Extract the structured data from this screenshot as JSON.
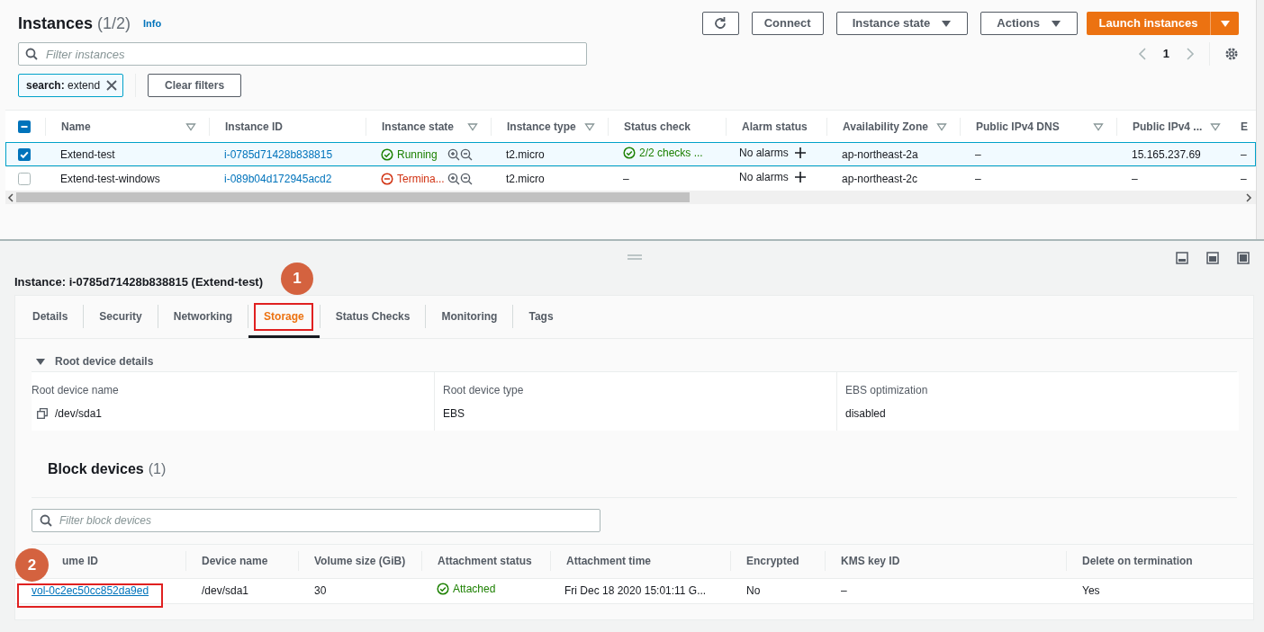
{
  "header": {
    "title": "Instances",
    "count": "(1/2)",
    "info": "Info"
  },
  "toolbar": [
    {
      "kind": "refresh"
    },
    {
      "kind": "plain",
      "label": "Connect"
    },
    {
      "kind": "dropdown",
      "label": "Instance state"
    },
    {
      "kind": "dropdown",
      "label": "Actions"
    },
    {
      "kind": "primary",
      "label": "Launch instances"
    }
  ],
  "filter": {
    "placeholder": "Filter instances"
  },
  "pagination": {
    "page": "1"
  },
  "tokens": [
    {
      "text": "**search:** extend"
    }
  ],
  "clear_filters": "Clear filters",
  "instances": {
    "header_indeterminate": true,
    "columns": [
      {
        "label": "Name",
        "filter": true
      },
      {
        "label": "Instance ID",
        "filter": false
      },
      {
        "label": "Instance state",
        "filter": true
      },
      {
        "label": "Instance type",
        "filter": true
      },
      {
        "label": "Status check",
        "filter": false
      },
      {
        "label": "Alarm status",
        "filter": false
      },
      {
        "label": "Availability Zone",
        "filter": true
      },
      {
        "label": "Public IPv4 DNS",
        "filter": true
      },
      {
        "label": "Public IPv4 ...",
        "filter": true
      },
      {
        "label": "E",
        "filter": false
      }
    ],
    "rows": [
      {
        "selected": true,
        "name": "Extend-test",
        "id": "i-0785d71428b838815",
        "state": {
          "kind": "running",
          "text": "Running"
        },
        "type": "t2.micro",
        "status_check": {
          "kind": "ok",
          "text": "2/2 checks ..."
        },
        "alarm": "No alarms",
        "zone": "ap-northeast-2a",
        "dns": "–",
        "ipv4": "15.165.237.69",
        "column_10": "–"
      },
      {
        "selected": false,
        "name": "Extend-test-windows",
        "id": "i-089b04d172945acd2",
        "state": {
          "kind": "terminated",
          "text": "Termina..."
        },
        "type": "t2.micro",
        "status_check": {
          "kind": "none",
          "text": "–"
        },
        "alarm": "No alarms",
        "zone": "ap-northeast-2c",
        "dns": "–",
        "ipv4": "–",
        "column_10": "–"
      }
    ]
  },
  "detail": {
    "title": "Instance: i-0785d71428b838815 (Extend-test)",
    "tabs": [
      {
        "label": "Details",
        "selected": false
      },
      {
        "label": "Security",
        "selected": false
      },
      {
        "label": "Networking",
        "selected": false
      },
      {
        "label": "Storage",
        "selected": true,
        "callout": "1"
      },
      {
        "label": "Status Checks",
        "selected": false
      },
      {
        "label": "Monitoring",
        "selected": false
      },
      {
        "label": "Tags",
        "selected": false
      }
    ],
    "root_device": {
      "heading": "Root device details",
      "expanded": true,
      "fields": [
        {
          "label": "Root device name",
          "value": "/dev/sda1",
          "copyable": true
        },
        {
          "label": "Root device type",
          "value": "EBS",
          "copyable": false
        },
        {
          "label": "EBS optimization",
          "value": "disabled",
          "copyable": false
        }
      ]
    },
    "block_devices": {
      "title": "Block devices",
      "count": "(1)",
      "filter_placeholder": "Filter block devices",
      "columns": [
        "ume ID",
        "Device name",
        "Volume size (GiB)",
        "Attachment status",
        "Attachment time",
        "Encrypted",
        "KMS key ID",
        "Delete on termination"
      ],
      "rows": [
        {
          "volume_id": "vol-0c2ec50cc852da9ed",
          "callout": "2",
          "device": "/dev/sda1",
          "size": "30",
          "attachment_status": {
            "kind": "ok",
            "text": "Attached"
          },
          "attachment_time": "Fri Dec 18 2020 15:01:11 G...",
          "encrypted": "No",
          "kms_key": "–",
          "delete_on_termination": "Yes"
        }
      ]
    }
  }
}
